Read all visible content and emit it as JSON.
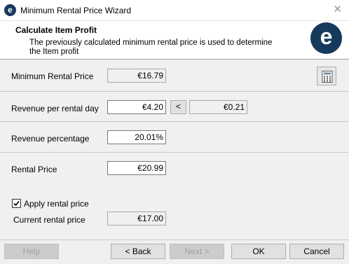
{
  "window": {
    "title": "Minimum Rental Price Wizard",
    "app_icon_letter": "e",
    "close_glyph": "✕"
  },
  "header": {
    "title": "Calculate Item Profit",
    "description": "The previously calculated minimum rental price is used to determine the Item profit",
    "logo_letter": "e",
    "logo_color": "#163a5c"
  },
  "fields": {
    "min_rental_price": {
      "label": "Minimum Rental Price",
      "value": "€16.79"
    },
    "revenue_per_day": {
      "label": "Revenue per rental day",
      "value": "€4.20",
      "arrow": "<",
      "computed": "€0.21"
    },
    "revenue_percentage": {
      "label": "Revenue percentage",
      "value": "20.01%"
    },
    "rental_price": {
      "label": "Rental Price",
      "value": "€20.99"
    },
    "apply": {
      "label": "Apply rental price",
      "checked": true
    },
    "current_rental_price": {
      "label": "Current rental price",
      "value": "€17.00"
    }
  },
  "icons": {
    "calculator": "calculator-icon"
  },
  "buttons": {
    "help": "Help",
    "back": "< Back",
    "next": "Next >",
    "ok": "OK",
    "cancel": "Cancel"
  }
}
